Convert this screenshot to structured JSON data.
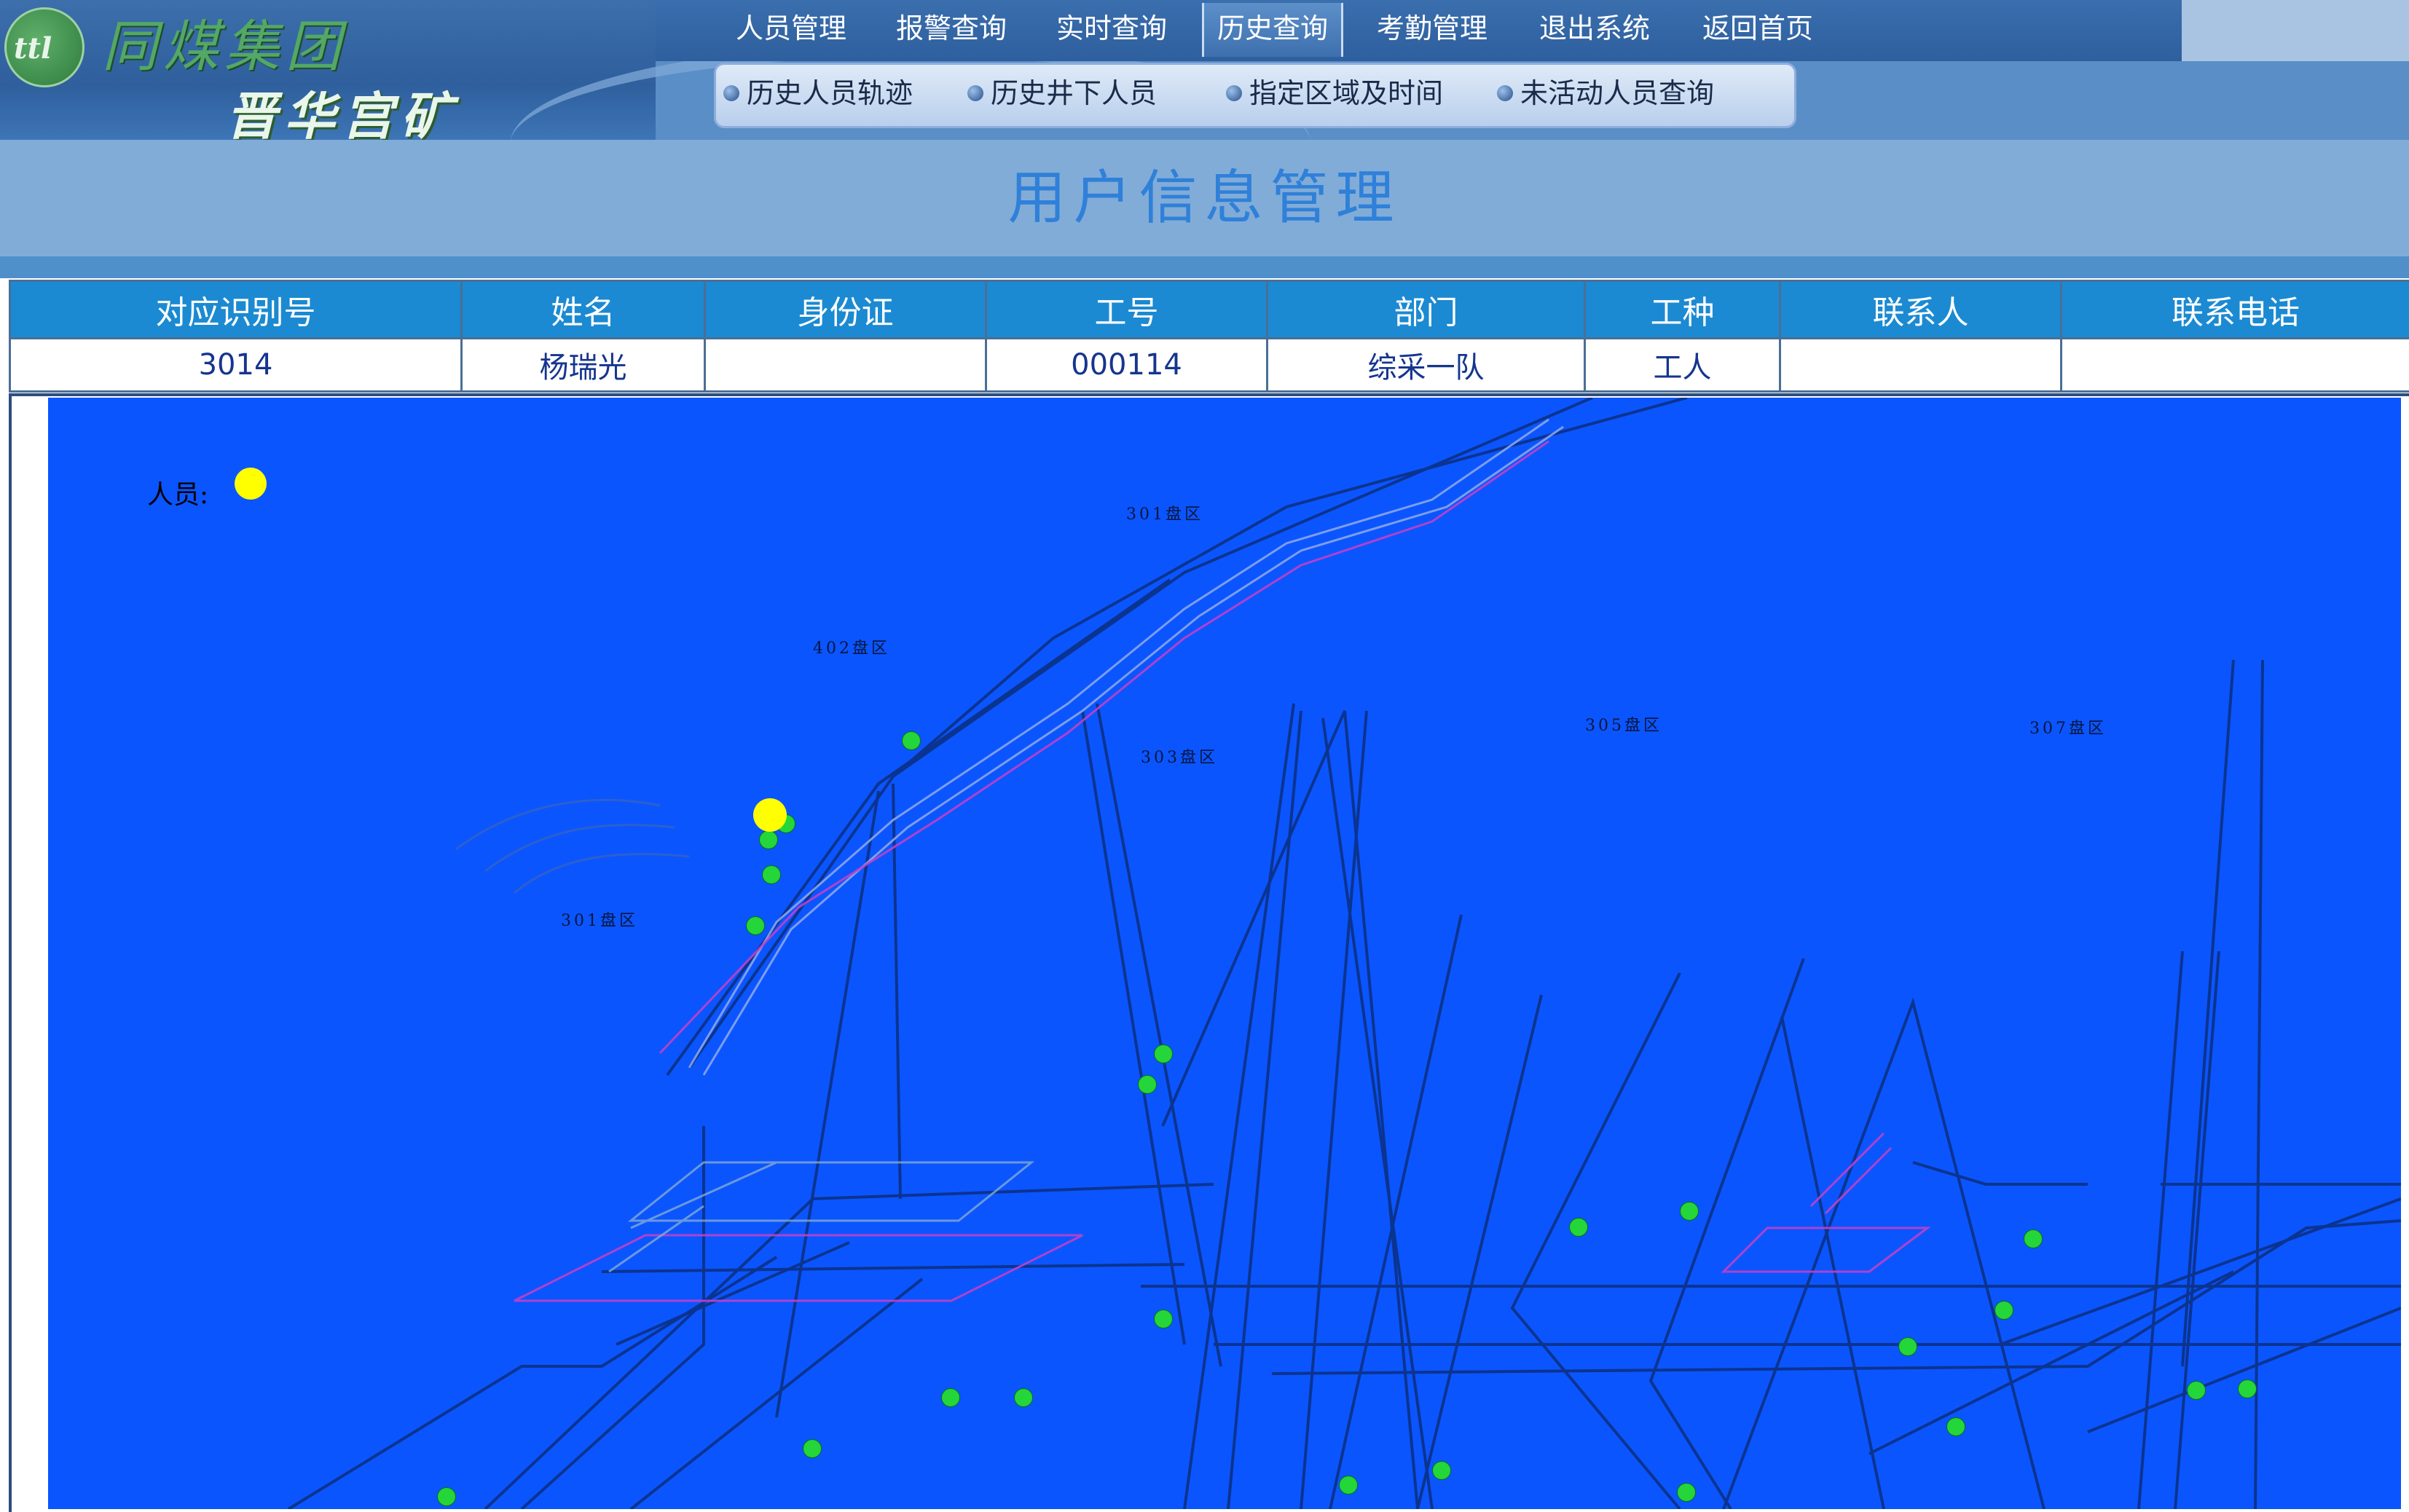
{
  "header": {
    "company_name": "同煤集团",
    "mine_name": "晋华宫矿",
    "logo_mark": "ttl"
  },
  "nav": {
    "items": [
      "人员管理",
      "报警查询",
      "实时查询",
      "历史查询",
      "考勤管理",
      "退出系统",
      "返回首页"
    ],
    "active": "历史查询"
  },
  "subnav": {
    "items": [
      "历史人员轨迹",
      "历史井下人员",
      "指定区域及时间",
      "未活动人员查询"
    ]
  },
  "page_title": "用户信息管理",
  "info_table": {
    "columns": [
      "对应识别号",
      "姓名",
      "身份证",
      "工号",
      "部门",
      "工种",
      "联系人",
      "联系电话"
    ],
    "row": [
      "3014",
      "杨瑞光",
      "",
      "000114",
      "综采一队",
      "工人",
      "",
      ""
    ]
  },
  "map": {
    "legend_label": "人员:",
    "background_color": "#0b55ff",
    "person_marker_color": "#ffff00",
    "zones": [
      "301盘区",
      "402盘区",
      "303盘区",
      "305盘区",
      "307盘区",
      "301盘区"
    ]
  },
  "icons": {
    "bullet": "round-bullet-icon",
    "station": "green-station-icon",
    "person": "yellow-person-dot"
  }
}
